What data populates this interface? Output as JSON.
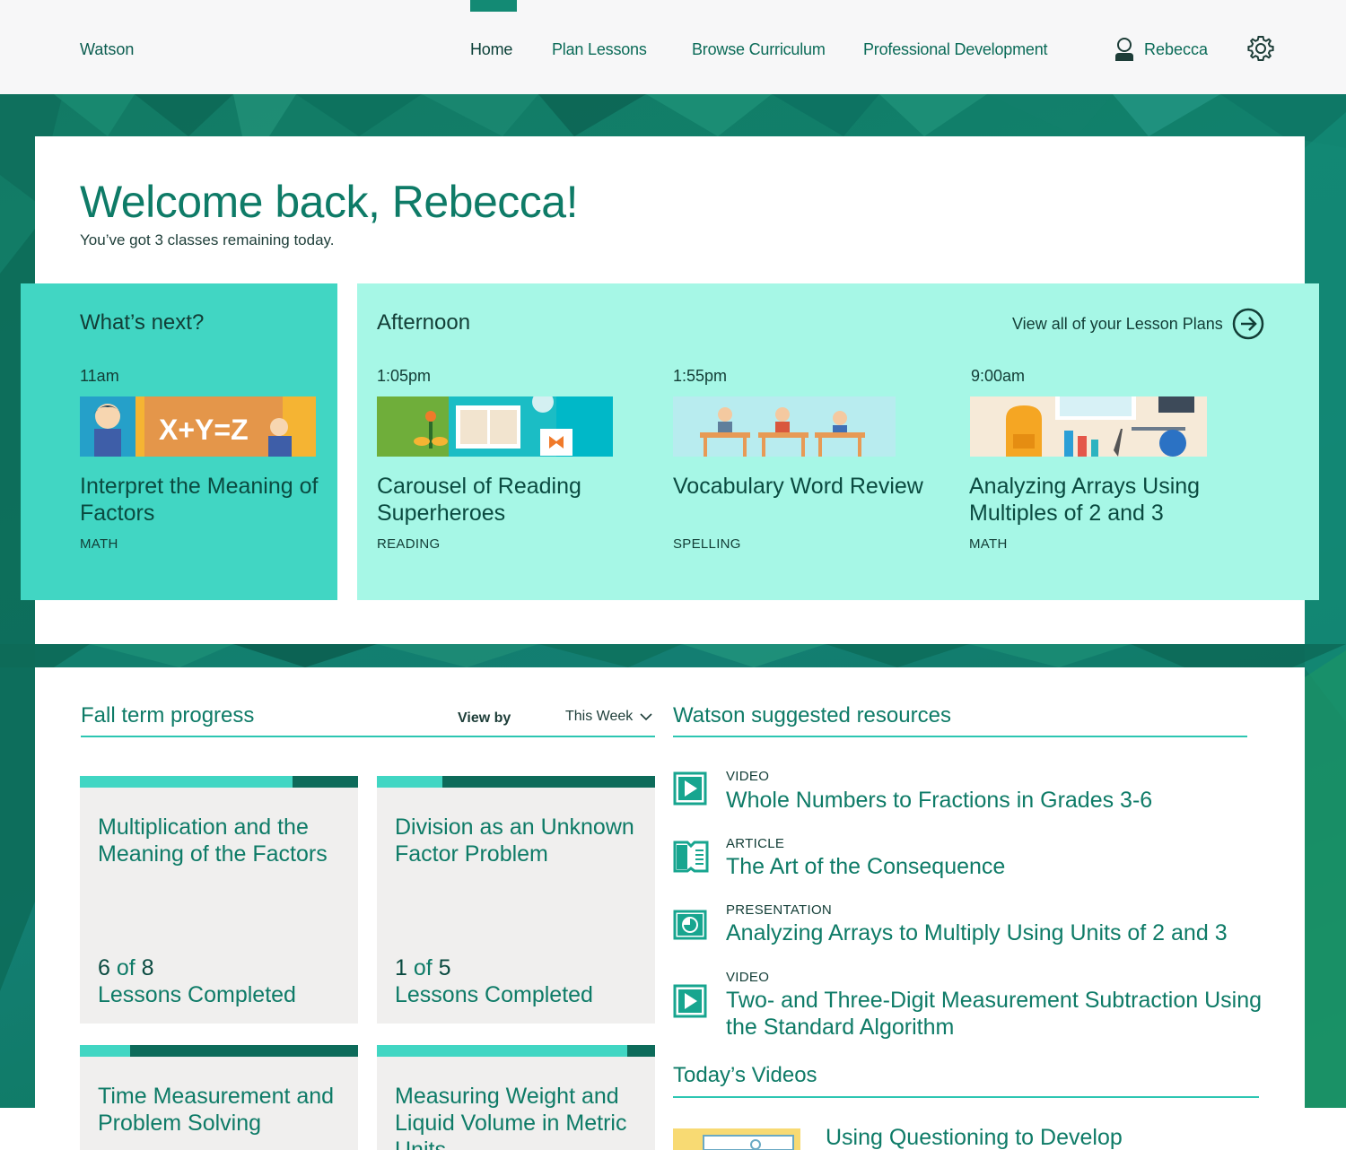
{
  "header": {
    "brand": "Watson",
    "nav": [
      "Home",
      "Plan Lessons",
      "Browse Curriculum",
      "Professional Development"
    ],
    "active_nav": "Home",
    "user_name": "Rebecca",
    "user_icon": "user-icon",
    "settings_icon": "gear-icon"
  },
  "welcome": {
    "title": "Welcome back, Rebecca!",
    "subtitle": "You’ve got 3 classes remaining today."
  },
  "next": {
    "heading": "What’s next?",
    "lesson": {
      "time": "11am",
      "title": "Interpret the Meaning of Factors",
      "subject": "MATH",
      "thumb_text": "X+Y=Z"
    }
  },
  "afternoon": {
    "heading": "Afternoon",
    "view_all": "View all of your Lesson Plans",
    "lessons": [
      {
        "time": "1:05pm",
        "title": "Carousel of Reading Superheroes",
        "subject": "READING"
      },
      {
        "time": "1:55pm",
        "title": "Vocabulary Word Review",
        "subject": "SPELLING"
      },
      {
        "time": "9:00am",
        "title": "Analyzing Arrays Using Multiples of 2 and 3",
        "subject": "MATH"
      }
    ]
  },
  "progress": {
    "heading": "Fall term progress",
    "view_by_label": "View by",
    "view_by_value": "This Week",
    "cards": [
      {
        "title": "Multiplication and the Meaning of the Factors",
        "completed": "6",
        "of": "of",
        "total": "8",
        "caption": "Lessons Completed",
        "fraction": 0.765
      },
      {
        "title": "Division as an Unknown Factor Problem",
        "completed": "1",
        "of": "of",
        "total": "5",
        "caption": "Lessons Completed",
        "fraction": 0.235
      },
      {
        "title": "Time Measurement and Problem Solving",
        "completed": "",
        "of": "",
        "total": "",
        "caption": "",
        "fraction": 0.18
      },
      {
        "title": "Measuring Weight and Liquid Volume in Metric Units",
        "completed": "",
        "of": "",
        "total": "",
        "caption": "",
        "fraction": 0.9
      }
    ]
  },
  "resources": {
    "heading": "Watson suggested resources",
    "items": [
      {
        "type": "VIDEO",
        "title": "Whole Numbers to Fractions in Grades 3-6",
        "icon": "video-icon"
      },
      {
        "type": "ARTICLE",
        "title": "The Art of the Consequence",
        "icon": "article-icon"
      },
      {
        "type": "PRESENTATION",
        "title": "Analyzing Arrays to Multiply Using Units of 2 and 3",
        "icon": "presentation-icon"
      },
      {
        "type": "VIDEO",
        "title": "Two- and Three-Digit Measurement Subtraction Using the Standard Algorithm",
        "icon": "video-icon"
      }
    ]
  },
  "videos": {
    "heading": "Today’s Videos",
    "items": [
      {
        "title": "Using Questioning to Develop"
      }
    ]
  },
  "colors": {
    "brand_teal": "#0e7b67",
    "next_panel": "#41d6c3",
    "afternoon_panel": "#a6f7e6",
    "progress_dark": "#0d6b5a",
    "card_bg": "#f0efee"
  }
}
